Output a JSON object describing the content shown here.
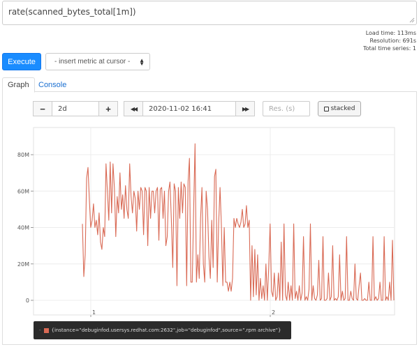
{
  "query": {
    "expression": "rate(scanned_bytes_total[1m])"
  },
  "stats": {
    "load_time": "Load time: 113ms",
    "resolution": "Resolution: 691s",
    "total_series": "Total time series: 1"
  },
  "toolbar": {
    "execute_label": "Execute",
    "metric_select_label": "- insert metric at cursor -"
  },
  "tabs": [
    {
      "label": "Graph",
      "active": true
    },
    {
      "label": "Console",
      "active": false
    }
  ],
  "graph_controls": {
    "range_minus": "−",
    "range_value": "2d",
    "range_plus": "+",
    "time_back": "◀◀",
    "end_time": "2020-11-02 16:41",
    "time_forward": "▶▶",
    "resolution_placeholder": "Res. (s)",
    "stacked_label": "stacked"
  },
  "legend": {
    "dash": "-",
    "series_label": "{instance=\"debuginfod.usersys.redhat.com:2632\",job=\"debuginfod\",source=\".rpm archive\"}",
    "color": "#d96a55"
  },
  "chart_data": {
    "type": "line",
    "y_ticks": [
      "0",
      "20M",
      "40M",
      "60M",
      "80M"
    ],
    "x_ticks": [
      "1",
      "2"
    ],
    "ylim": [
      0,
      90000000
    ],
    "grid": true,
    "series": [
      {
        "color": "#d96a55",
        "values": [
          42000000,
          13000000,
          25000000,
          67000000,
          73000000,
          55000000,
          40000000,
          44000000,
          53000000,
          40000000,
          44000000,
          36000000,
          48000000,
          32000000,
          28000000,
          40000000,
          35000000,
          75000000,
          60000000,
          44000000,
          76000000,
          48000000,
          75000000,
          62000000,
          35000000,
          57000000,
          48000000,
          70000000,
          50000000,
          58000000,
          45000000,
          63000000,
          50000000,
          45000000,
          75000000,
          57000000,
          48000000,
          60000000,
          56000000,
          38000000,
          60000000,
          50000000,
          62000000,
          60000000,
          36000000,
          62000000,
          60000000,
          30000000,
          62000000,
          45000000,
          60000000,
          60000000,
          48000000,
          60000000,
          62000000,
          33000000,
          61000000,
          62000000,
          45000000,
          60000000,
          30000000,
          35000000,
          60000000,
          65000000,
          44000000,
          18000000,
          64000000,
          60000000,
          8000000,
          62000000,
          45000000,
          65000000,
          48000000,
          64000000,
          62000000,
          8000000,
          65000000,
          78000000,
          10000000,
          10000000,
          50000000,
          86000000,
          10000000,
          25000000,
          12000000,
          45000000,
          62000000,
          20000000,
          10000000,
          60000000,
          50000000,
          24000000,
          12000000,
          44000000,
          18000000,
          68000000,
          72000000,
          10000000,
          42000000,
          62000000,
          40000000,
          8000000,
          40000000,
          10000000,
          10000000,
          5000000,
          10000000,
          5000000,
          12000000,
          45000000,
          40000000,
          45000000,
          42000000,
          40000000,
          43000000,
          50000000,
          40000000,
          42000000,
          52000000,
          40000000,
          44000000,
          0,
          30000000,
          2000000,
          28000000,
          3000000,
          25000000,
          0,
          12000000,
          1000000,
          8000000,
          0,
          20000000,
          0,
          18000000,
          42000000,
          5000000,
          2000000,
          15000000,
          0,
          2000000,
          15000000,
          0,
          32000000,
          0,
          42000000,
          3000000,
          0,
          10000000,
          0,
          8000000,
          0,
          42000000,
          1000000,
          5000000,
          0,
          8000000,
          0,
          4000000,
          35000000,
          0,
          2000000,
          0,
          6000000,
          42000000,
          0,
          8000000,
          1000000,
          0,
          3000000,
          22000000,
          0,
          1000000,
          35000000,
          0,
          0,
          1000000,
          15000000,
          0,
          2000000,
          30000000,
          0,
          1000000,
          0,
          2000000,
          25000000,
          0,
          5000000,
          0,
          1000000,
          35000000,
          0,
          0,
          5000000,
          1000000,
          0,
          20000000,
          1000000,
          0,
          8000000,
          15000000,
          0,
          0,
          1000000,
          0,
          0,
          10000000,
          0,
          0,
          35000000,
          0,
          2000000,
          0,
          1000000,
          10000000,
          0,
          0,
          35000000,
          0,
          2000000,
          0,
          10000000,
          0,
          33000000,
          0
        ]
      }
    ]
  }
}
